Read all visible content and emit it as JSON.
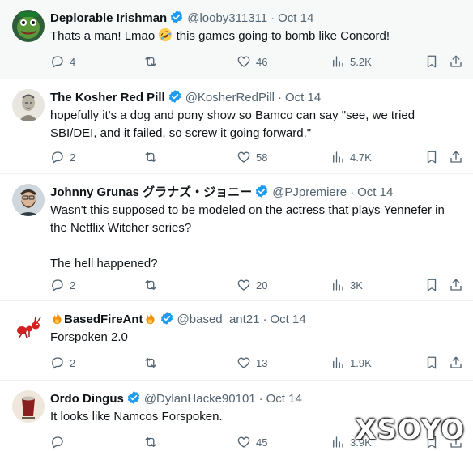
{
  "colors": {
    "text": "#0f1419",
    "muted": "#536471",
    "verified": "#1d9bf0",
    "divider": "#eff3f4",
    "highlight_bg": "#f7f9f9"
  },
  "tweets": [
    {
      "display_name": "Deplorable Irishman",
      "verified": true,
      "handle": "@looby311311",
      "time": "Oct 14",
      "text_before_emoji": "Thats a man! Lmao ",
      "emoji": "rolling-on-floor-laughing-emoji",
      "text_after_emoji": " this games going to bomb like Concord!",
      "replies": "4",
      "retweets": "",
      "likes": "46",
      "views": "5.2K",
      "avatar": "frog-avatar"
    },
    {
      "display_name": "The Kosher Red Pill",
      "verified": true,
      "handle": "@KosherRedPill",
      "time": "Oct 14",
      "text": "hopefully it's a dog and pony show so Bamco can say \"see, we tried SBI/DEI, and it failed, so screw it going forward.\"",
      "replies": "2",
      "retweets": "",
      "likes": "58",
      "views": "4.7K",
      "avatar": "portrait-sketch-avatar"
    },
    {
      "display_name": "Johnny Grunas グラナズ・ジョニー",
      "verified": true,
      "handle": "@PJpremiere",
      "time": "Oct 14",
      "text": "Wasn't this supposed to be modeled on the actress that plays Yennefer in the Netflix Witcher series?\n\nThe hell happened?",
      "replies": "2",
      "retweets": "",
      "likes": "20",
      "views": "3K",
      "avatar": "bearded-man-avatar"
    },
    {
      "display_name": "BasedFireAnt",
      "name_prefix_emoji": "fire-emoji",
      "name_suffix_emoji": "fire-emoji",
      "verified": true,
      "handle": "@based_ant21",
      "time": "Oct 14",
      "text": "Forspoken 2.0",
      "replies": "2",
      "retweets": "",
      "likes": "13",
      "views": "1.9K",
      "avatar": "red-ant-avatar"
    },
    {
      "display_name": "Ordo Dingus",
      "verified": true,
      "handle": "@DylanHacke90101",
      "time": "Oct 14",
      "text": "It looks like Namcos Forspoken.",
      "replies": "",
      "retweets": "",
      "likes": "45",
      "views": "3.9K",
      "avatar": "cup-avatar"
    }
  ],
  "separator": "·",
  "watermark": "XSOYO"
}
